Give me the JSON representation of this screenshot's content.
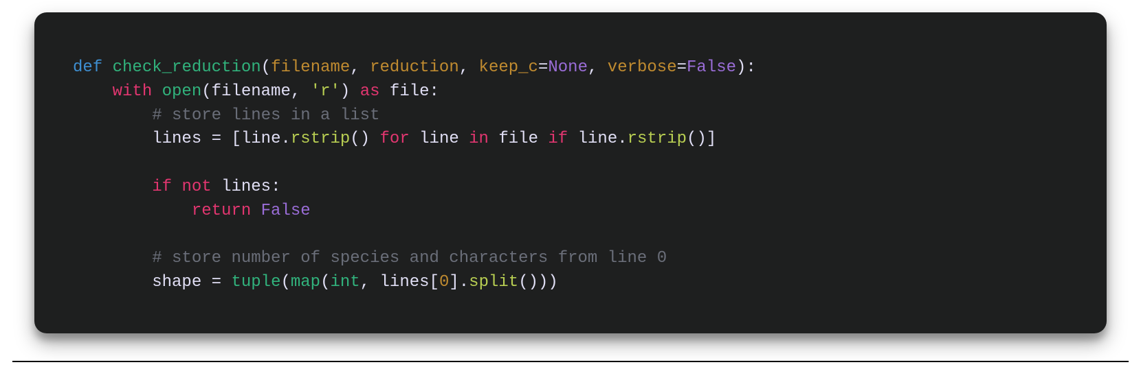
{
  "code": {
    "line1": {
      "def": "def",
      "fn": "check_reduction",
      "lp": "(",
      "p1": "filename",
      "c1": ", ",
      "p2": "reduction",
      "c2": ", ",
      "p3": "keep_c",
      "eq1": "=",
      "v1": "None",
      "c3": ", ",
      "p4": "verbose",
      "eq2": "=",
      "v2": "False",
      "rp": "):"
    },
    "line2": {
      "with": "with",
      "open": "open",
      "lp": "(",
      "arg1": "filename",
      "c1": ", ",
      "str": "'r'",
      "rp": ")",
      "as": "as",
      "file": "file",
      "colon": ":"
    },
    "line3": {
      "comment": "# store lines in a list"
    },
    "line4": {
      "var": "lines",
      "eq": " = ",
      "lb": "[",
      "iter": "line",
      "dot1": ".",
      "m1": "rstrip",
      "call1": "()",
      "for": "for",
      "ivar": "line",
      "in": "in",
      "src": "file",
      "if": "if",
      "cond": "line",
      "dot2": ".",
      "m2": "rstrip",
      "call2": "()",
      "rb": "]"
    },
    "line6": {
      "if": "if",
      "not": "not",
      "var": "lines",
      "colon": ":"
    },
    "line7": {
      "return": "return",
      "val": "False"
    },
    "line9": {
      "comment": "# store number of species and characters from line 0"
    },
    "line10": {
      "var": "shape",
      "eq": " = ",
      "tuple": "tuple",
      "lp": "(",
      "map": "map",
      "lp2": "(",
      "int": "int",
      "c1": ", ",
      "lines": "lines",
      "lb": "[",
      "idx": "0",
      "rb": "]",
      "dot": ".",
      "split": "split",
      "call": "()",
      "rp2": ")",
      "rp": ")"
    }
  }
}
